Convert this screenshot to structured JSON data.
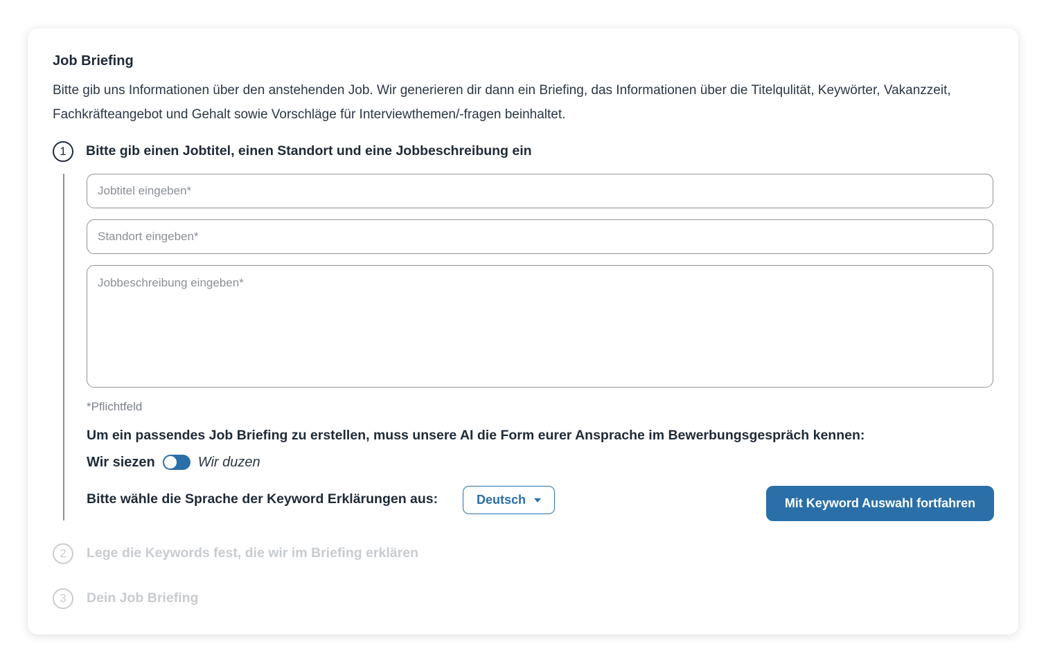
{
  "header": {
    "title": "Job Briefing",
    "intro": "Bitte gib uns Informationen über den anstehenden Job. Wir generieren dir dann ein Briefing, das Informationen über die Titelqulität, Keywörter, Vakanzzeit, Fachkräfteangebot und Gehalt sowie Vorschläge für Interviewthemen/-fragen beinhaltet."
  },
  "steps": [
    {
      "number": "1",
      "title": "Bitte gib einen Jobtitel, einen Standort und eine Jobbeschreibung ein",
      "active": true
    },
    {
      "number": "2",
      "title": "Lege die Keywords fest, die wir im Briefing erklären",
      "active": false
    },
    {
      "number": "3",
      "title": "Dein Job Briefing",
      "active": false
    }
  ],
  "form": {
    "jobtitle_placeholder": "Jobtitel eingeben*",
    "jobtitle_value": "",
    "location_placeholder": "Standort eingeben*",
    "location_value": "",
    "description_placeholder": "Jobbeschreibung eingeben*",
    "description_value": "",
    "required_note": "*Pflichtfeld",
    "address_question": "Um ein passendes Job Briefing zu erstellen, muss unsere AI die Form eurer Ansprache im Bewerbungsgespräch kennen:",
    "toggle_left": "Wir siezen",
    "toggle_right": "Wir duzen",
    "toggle_state": "siezen",
    "language_label": "Bitte wähle die Sprache der Keyword Erklärungen aus:",
    "language_selected": "Deutsch",
    "continue_button": "Mit Keyword Auswahl fortfahren"
  },
  "colors": {
    "accent": "#2a6fa8",
    "text": "#1e2a38",
    "inactive": "#c8ccd0"
  }
}
